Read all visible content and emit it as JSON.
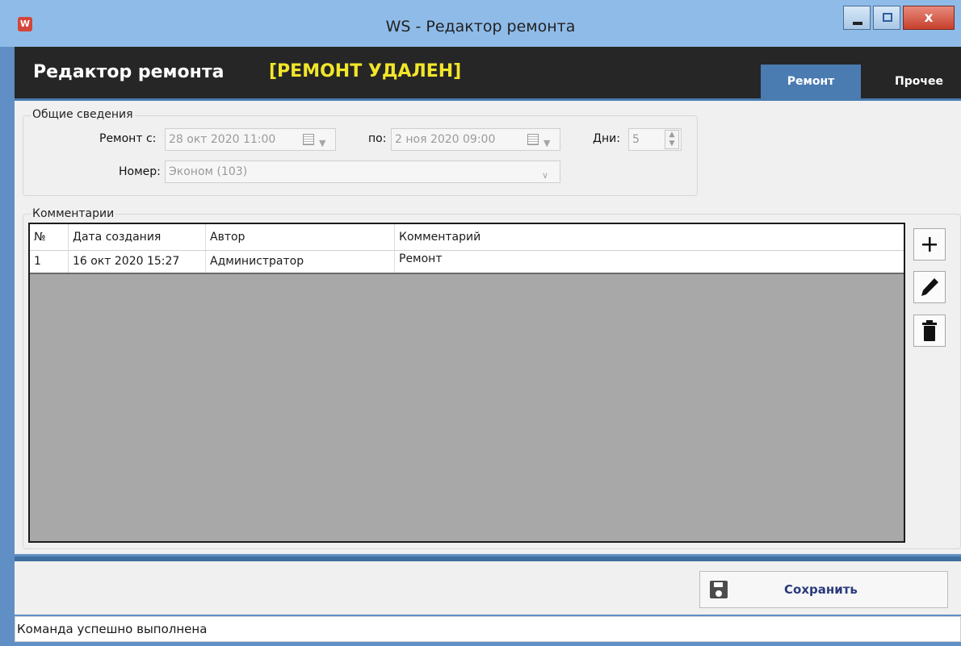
{
  "window": {
    "title": "WS - Редактор ремонта",
    "icon": "app-w-icon",
    "close_label": "x"
  },
  "header": {
    "title": "Редактор ремонта",
    "status": "[РЕМОНТ УДАЛЕН]",
    "tabs": [
      {
        "label": "Ремонт",
        "active": true
      },
      {
        "label": "Прочее",
        "active": false
      }
    ]
  },
  "general": {
    "caption": "Общие сведения",
    "from_label": "Ремонт с:",
    "from_value": "28 окт 2020 11:00",
    "to_label": "по:",
    "to_value": "2 ноя 2020 09:00",
    "days_label": "Дни:",
    "days_value": "5",
    "room_label": "Номер:",
    "room_value": "Эконом (103)"
  },
  "comments": {
    "caption": "Комментарии",
    "columns": [
      "№",
      "Дата создания",
      "Автор",
      "Комментарий"
    ],
    "rows": [
      {
        "num": "1",
        "date": "16 окт 2020 15:27",
        "author": "Администратор",
        "comment": "Ремонт"
      }
    ],
    "actions": [
      "plus-icon",
      "pencil-icon",
      "trash-icon"
    ]
  },
  "footer": {
    "save_label": "Сохранить",
    "status_text": "Команда успешно выполнена"
  },
  "colors": {
    "header_bg": "#262626",
    "status_yellow": "#f2e62a",
    "active_tab": "#4a7bb1",
    "grid_empty": "#a8a8a8"
  }
}
